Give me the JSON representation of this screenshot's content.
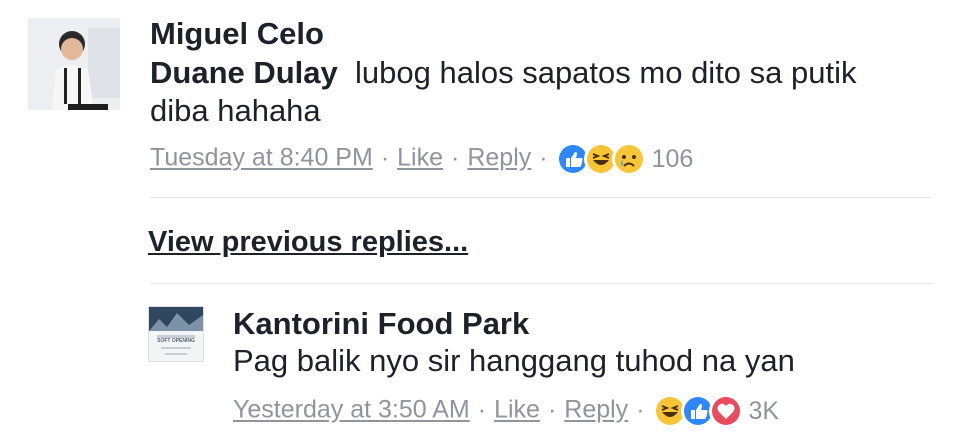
{
  "comment": {
    "author": "Miguel Celo",
    "tagged": "Duane Dulay",
    "text_line1": "lubog halos sapatos mo dito sa putik",
    "text_line2": "diba hahaha",
    "timestamp": "Tuesday at 8:40 PM",
    "like_label": "Like",
    "reply_label": "Reply",
    "reactions": [
      "like-icon",
      "haha-icon",
      "sad-icon"
    ],
    "reaction_count": "106"
  },
  "view_previous_label": "View previous replies...",
  "reply": {
    "author": "Kantorini Food Park",
    "avatar_caption": "SOFT OPENING",
    "text": "Pag balik nyo sir hanggang tuhod na yan",
    "timestamp": "Yesterday at 3:50 AM",
    "like_label": "Like",
    "reply_label": "Reply",
    "reactions": [
      "haha-icon",
      "like-icon",
      "love-icon"
    ],
    "reaction_count": "3K"
  },
  "colors": {
    "like": "#2d88ff",
    "love": "#e94b5c",
    "haha": "#f7c536",
    "meta": "#90949c"
  }
}
